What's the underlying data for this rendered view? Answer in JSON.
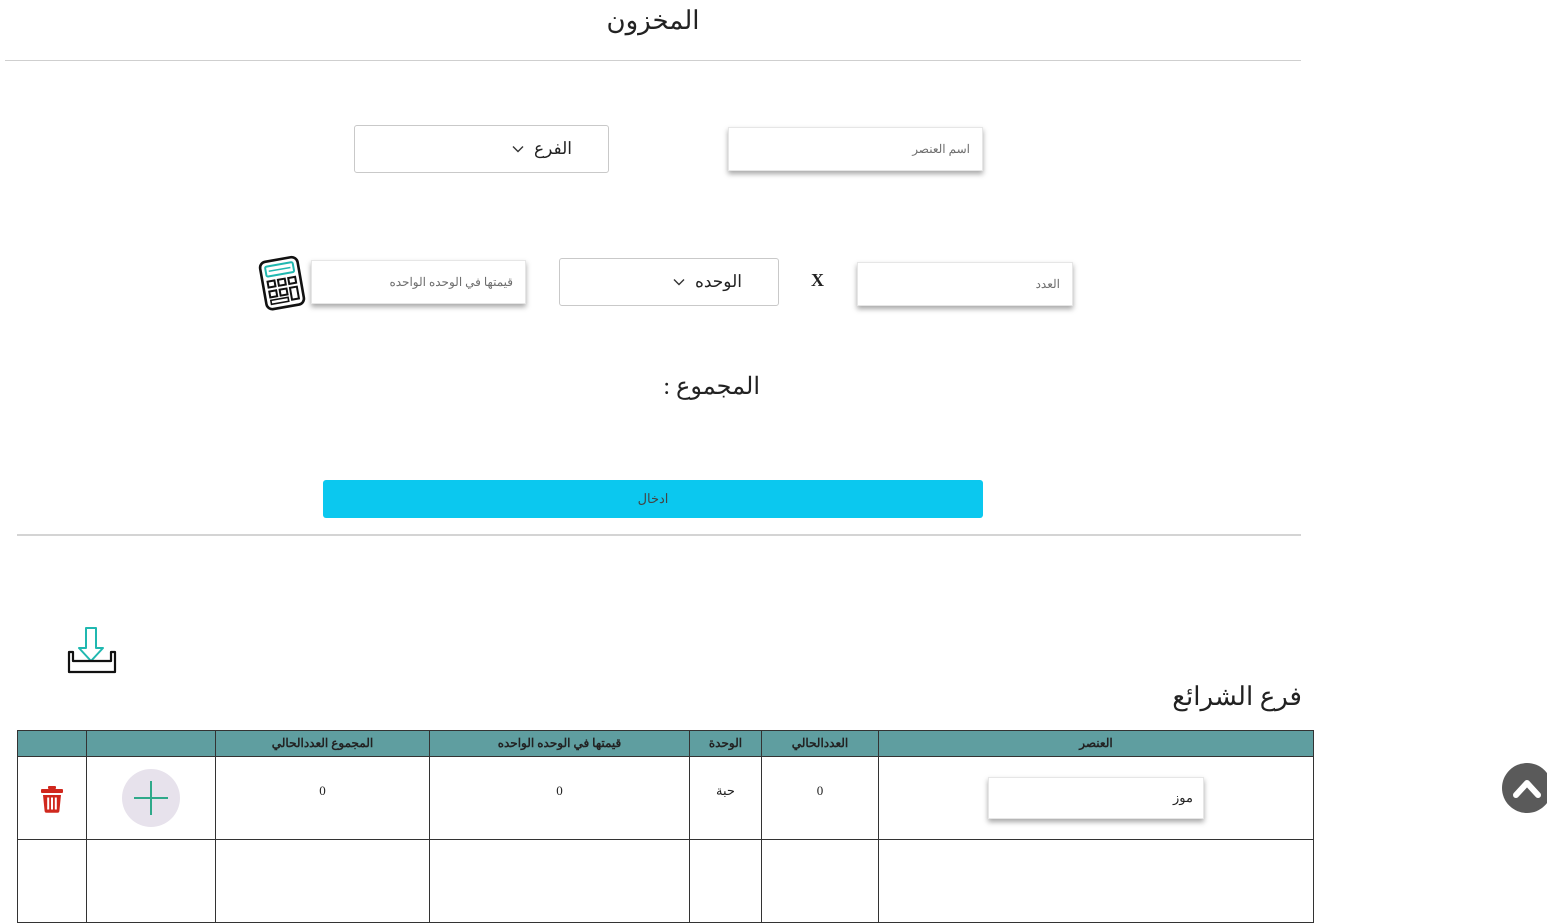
{
  "page": {
    "title": "المخزون"
  },
  "form": {
    "item_name_placeholder": "اسم العنصر",
    "branch_select_label": "الفرع",
    "count_placeholder": "العدد",
    "multiply_sign": "X",
    "unit_select_label": "الوحده",
    "unit_value_placeholder": "قيمتها في الوحده الواحده",
    "total_label": "المجموع :",
    "submit_label": "ادخال"
  },
  "icons": {
    "calculator": "calculator-icon",
    "download": "download-tray-icon",
    "add": "plus-icon",
    "delete": "trash-icon",
    "scroll_top": "chevron-up-icon"
  },
  "branch": {
    "title": "فرع الشرائع"
  },
  "table": {
    "headers": {
      "item": "العنصر",
      "current_count": "العددالحالي",
      "unit": "الوحدة",
      "unit_value": "قيمتها في الوحده الواحده",
      "current_total": "المجموع العددالحالي",
      "add": "",
      "delete": ""
    },
    "rows": [
      {
        "item": "موز",
        "current_count": "0",
        "unit": "حبة",
        "unit_value": "0",
        "current_total": "0"
      }
    ]
  },
  "colors": {
    "accent": "#0bc8ef",
    "table_header": "#5f9ea0",
    "delete_red": "#d0281e",
    "plus_green": "#2fa98a"
  }
}
